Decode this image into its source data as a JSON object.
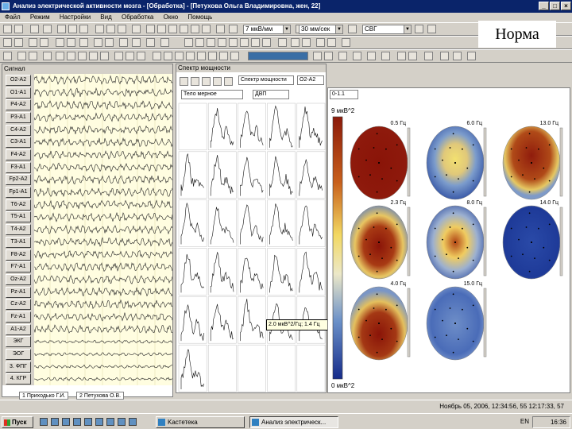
{
  "window": {
    "title": "Анализ электрической активности мозга - [Обработка] - [Петухова Ольга Владимировна, жен, 22]"
  },
  "menu": [
    "Файл",
    "Режим",
    "Настройки",
    "Вид",
    "Обработка",
    "Окно",
    "Помощь"
  ],
  "toolbar": {
    "sensitivity": "7 мкВ/мм",
    "speed": "30 мм/сек",
    "montage": "СВГ"
  },
  "overlay_label": "Норма",
  "eeg": {
    "panel_title": "Сигнал",
    "channels": [
      "O2-A2",
      "O1-A1",
      "P4-A2",
      "P3-A1",
      "C4-A2",
      "C3-A1",
      "F4-A2",
      "F3-A1",
      "Fp2-A2",
      "Fp1-A1",
      "T6-A2",
      "T5-A1",
      "T4-A2",
      "T3-A1",
      "F8-A2",
      "F7-A1",
      "Oz-A2",
      "Pz-A1",
      "Cz-A2",
      "Fz-A1",
      "A1-A2",
      "ЭКГ",
      "ЭОГ",
      "3. ФПГ",
      "4. КГР"
    ],
    "tabs": [
      "1 Приходько Г.И.",
      "2 Петухова О.В."
    ]
  },
  "spectrum": {
    "title": "Спектр мощности",
    "type_select": "Спектр мощности",
    "lead_select": "O2-A2",
    "display_select": "Тело мерное",
    "filter_select": "ДВП",
    "tooltip": "2.0 мкВ^2/Гц; 1.4 Гц"
  },
  "maps": {
    "range_select": "0-1.1",
    "unit_top": "9 мкВ^2",
    "unit_bottom": "0 мкВ^2",
    "freq_labels": [
      "0.5 Гц",
      "6.0 Гц",
      "13.0 Гц",
      "2.3 Гц",
      "8.0 Гц",
      "14.0 Гц",
      "4.0 Гц",
      "15.0 Гц"
    ]
  },
  "statusbar": {
    "text": "Ноябрь 05, 2006, 12:34:56, 55 12:17:33, 57"
  },
  "taskbar": {
    "start": "Пуск",
    "tasks": [
      "Kастетека",
      "Анализ электрическ..."
    ],
    "lang": "EN",
    "clock": "16:36"
  }
}
